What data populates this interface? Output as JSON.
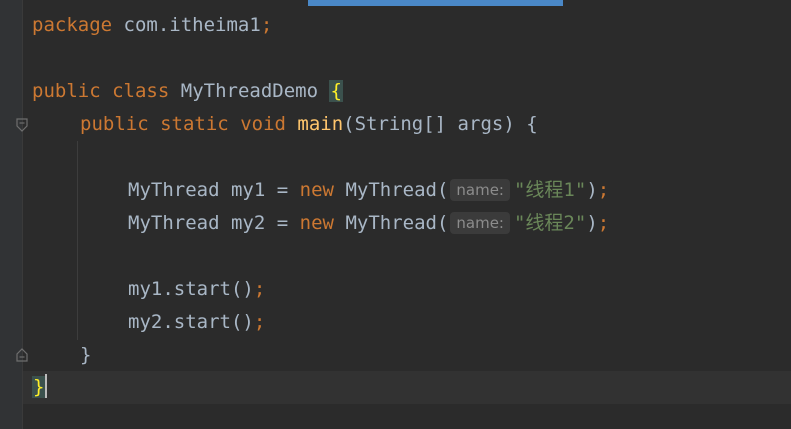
{
  "editor": {
    "lines": [
      {
        "kw": "package",
        "text": "com.itheima1",
        "semi": ";"
      },
      {
        "kw1": "public",
        "kw2": "class",
        "name": "MyThreadDemo",
        "brace": "{"
      },
      {
        "kw1": "public",
        "kw2": "static",
        "kw3": "void",
        "fn": "main",
        "rest": "(String[] args) {"
      },
      {
        "type": "MyThread",
        "var": "my1",
        "op": "=",
        "kw": "new",
        "ctor": "MyThread(",
        "hint": "name:",
        "str": "\"线程1\"",
        "close": ")",
        "semi": ";"
      },
      {
        "type": "MyThread",
        "var": "my2",
        "op": "=",
        "kw": "new",
        "ctor": "MyThread(",
        "hint": "name:",
        "str": "\"线程2\"",
        "close": ")",
        "semi": ";"
      },
      {
        "call": "my1.start()",
        "semi": ";"
      },
      {
        "call": "my2.start()",
        "semi": ";"
      },
      {
        "brace": "}"
      },
      {
        "brace": "}"
      }
    ]
  },
  "colors": {
    "background": "#2b2b2b",
    "keyword": "#cc7832",
    "function": "#ffc66d",
    "string": "#6a8759",
    "text": "#a9b7c6",
    "scroll_indicator": "#4a88c7"
  }
}
